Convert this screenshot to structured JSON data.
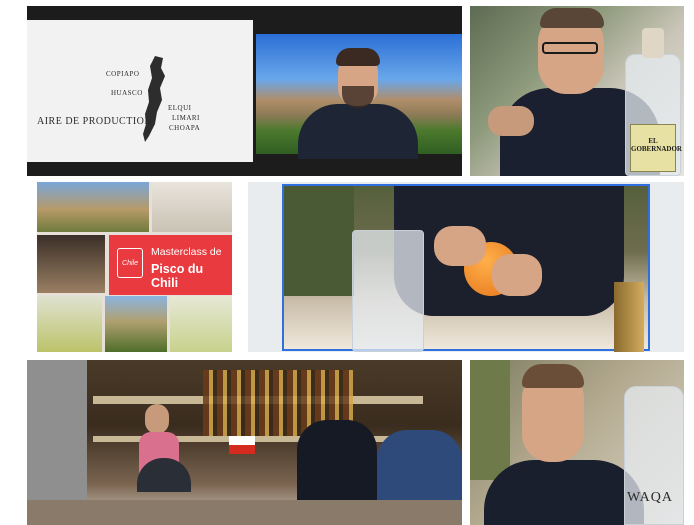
{
  "grid": {
    "tile1": {
      "map": {
        "title": "AIRE DE PRODUCTION",
        "regions": [
          "COPIAPO",
          "HUASCO",
          "ELQUI",
          "LIMARI",
          "CHOAPA"
        ]
      }
    },
    "tile2": {
      "bottle_label": [
        "EL",
        "GOBERNADOR"
      ]
    },
    "tile3": {
      "promo": {
        "line1": "Masterclass de",
        "line2": "Pisco du Chili",
        "logo": "Chile"
      }
    },
    "tile6": {
      "bottle_label": "WAQA"
    }
  },
  "colors": {
    "accent_red": "#e83a3f",
    "active_speaker_border": "#2f6fe0"
  }
}
